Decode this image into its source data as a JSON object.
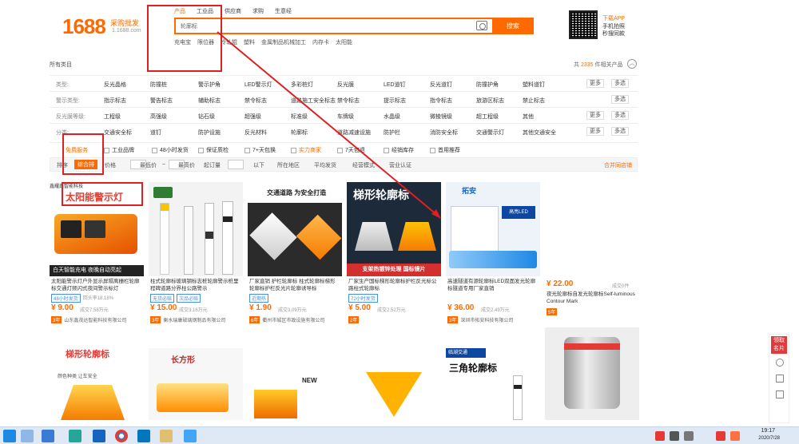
{
  "header": {
    "logo": "1688",
    "logo_tagline": "采购批发",
    "logo_domain": "1.1688.com",
    "search_tabs": [
      "产品",
      "工业品",
      "供应商",
      "求购",
      "生意经"
    ],
    "search_value": "轮廓标",
    "search_button": "搜索",
    "hot_words": [
      "充电宝",
      "限位器",
      "冷轧辊",
      "塑料",
      "金属制品机械加工",
      "内存卡",
      "太阳能"
    ],
    "app_line1": "下载APP",
    "app_line2": "手机拍照",
    "app_line3": "秒搜同款"
  },
  "filters": {
    "all_categories": "所有类目",
    "total_prefix": "共",
    "total_count": "2335",
    "total_suffix": "件相关产品",
    "rows": [
      {
        "label": "类型:",
        "options": [
          "反光晶格",
          "防撞桩",
          "警示护角",
          "LED警示灯",
          "多彩桩灯",
          "反光膜",
          "LED道钉",
          "反光道钉",
          "防撞护角",
          "塑料道钉"
        ]
      },
      {
        "label": "警示类型:",
        "options": [
          "指示标志",
          "警告标志",
          "辅助标志",
          "禁令标志",
          "道路施工安全标志",
          "禁令标志",
          "提示标志",
          "指令标志",
          "旅游区标志",
          "禁止标志"
        ]
      },
      {
        "label": "反光膜等级:",
        "options": [
          "工程级",
          "高强级",
          "钻石级",
          "超强级",
          "标准级",
          "车牌级",
          "水晶级",
          "微棱镜级",
          "超工程级",
          "其他"
        ]
      },
      {
        "label": "分类:",
        "options": [
          "交通安全标",
          "道钉",
          "防护设施",
          "反光材料",
          "轮廓标",
          "道路减速设施",
          "防护栏",
          "消防安全标",
          "交通警示灯",
          "其他交通安全"
        ]
      }
    ],
    "more_label": "更多",
    "multi_label": "多选"
  },
  "service": [
    "免费服务",
    "工业品牌",
    "48小时发货",
    "保证质检",
    "7+天包换",
    "实力商家",
    "7天包退",
    "经销库存",
    "首用推荐"
  ],
  "sort": {
    "label": "排序",
    "selected": "综合排",
    "price": "价格",
    "min": "最低价",
    "max": "最高价",
    "qty": "起订量",
    "below": "以下",
    "location": "所在地区",
    "style": "平均发货",
    "more": "经营模式",
    "auth": "营业认证",
    "right": "合并同店铺"
  },
  "products": [
    {
      "store_tag": "鑫耀鑫智能科技",
      "banner": "太阳能警示灯",
      "caption": "白天智能充电   夜晚自动亮起",
      "title": "太阳能警示灯户外显示屏隔离栅栏轮廓标交通灯频闪式夜间警示标灯",
      "tags": [
        "48小时发货",
        "回头率18.18%"
      ],
      "price": "¥ 9.00",
      "sold": "成交7.58万元",
      "shop": "山东鑫茂达智能科技有限公司"
    },
    {
      "store_tag": "",
      "banner": "",
      "caption": "",
      "title": "柱式轮廓标玻璃钢标志桩轮廓警示桩里程碑道路分界柱公路警示",
      "tags": [
        "无货必赔",
        "次品必赔"
      ],
      "price": "¥ 15.00",
      "sold": "成交3.16万元",
      "shop": "衡水瑞康玻璃钢制品有限公司"
    },
    {
      "store_tag": "",
      "banner": "交通道路 为安全打造",
      "caption": "",
      "title": "厂家直销 护栏轮廓标 柱式轮廓标梯形轮廓标护栏反光片轮廓诱导标",
      "tags": [
        "近期热"
      ],
      "price": "¥ 1.90",
      "sold": "成交3.09万元",
      "shop": "衢州市城区市政设施有限公司"
    },
    {
      "store_tag": "",
      "banner": "梯形轮廓标",
      "caption": "支架热镀锌处理 国标镜片",
      "title": "厂家生产国标梯形轮廓标护栏反光标公路柱式轮廓标",
      "tags": [
        "72小时发货"
      ],
      "price": "¥ 5.00",
      "sold": "成交2.52万元",
      "shop": ""
    },
    {
      "store_tag": "",
      "banner": "拓安",
      "caption": "",
      "title": "高速隧道有源轮廓标LED双面发光轮廓标隧道专用厂家直销",
      "tags": [],
      "price": "¥ 36.00",
      "sold": "成交2.49万元",
      "shop": "深圳市拓安科技有限公司"
    },
    {
      "store_tag": "",
      "banner": "",
      "caption": "",
      "title": "夜光轮廓标自发光轮廓标Self-luminous Contour Mark",
      "tags": [],
      "price": "¥ 22.00",
      "sold": "成交0件",
      "shop": ""
    }
  ],
  "bottom_row": [
    {
      "banner": "梯形轮廓标",
      "caption": "颜色种类 让车安全"
    },
    {
      "banner": "长方形",
      "caption": ""
    },
    {
      "banner": "NEW",
      "caption": ""
    },
    {
      "banner": "",
      "caption": ""
    },
    {
      "banner": "三角轮廓标",
      "caption": "临湖交通"
    },
    {
      "banner": "",
      "caption": ""
    }
  ],
  "right_bar": {
    "top": "领取名片"
  },
  "clock": {
    "time": "19:17",
    "date": "2020/7/28"
  },
  "colors": {
    "accent": "#ff6a00",
    "red_box": "#e02020"
  }
}
